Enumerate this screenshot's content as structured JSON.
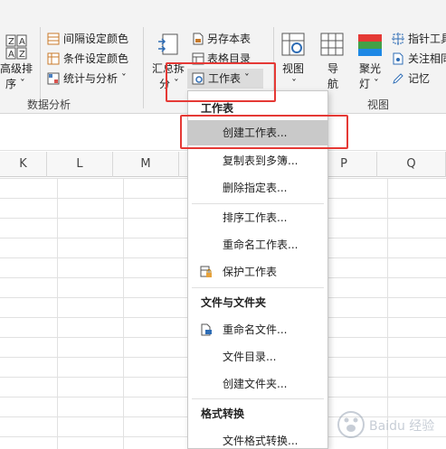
{
  "ribbon": {
    "sort_label_line1": "高级排",
    "sort_label_line2": "序 ˇ",
    "interval_color": "间隔设定颜色",
    "condition_color": "条件设定颜色",
    "stats_analysis": "统计与分析 ˇ",
    "data_analysis_group": "数据分析",
    "summarize_split_line1": "汇总拆",
    "summarize_split_line2": "分 ˇ",
    "save_sheet": "另存本表",
    "table_catalog": "表格目录",
    "worksheet_button": "工作表 ˇ",
    "view_line1": "视图",
    "view_line2": "ˇ",
    "nav_line1": "导",
    "nav_line2": "航",
    "spotlight_line1": "聚光",
    "spotlight_line2": "灯 ˇ",
    "pointer_tool": "指针工具",
    "focus_related": "关注相同",
    "note": "记忆",
    "view_group": "视图"
  },
  "columns": [
    "K",
    "L",
    "M",
    "N",
    "O",
    "P",
    "Q"
  ],
  "menu": {
    "section_worksheet": "工作表",
    "create_sheet": "创建工作表...",
    "copy_sheet": "复制表到多簿...",
    "delete_sheet": "删除指定表...",
    "sort_sheet": "排序工作表...",
    "rename_sheet": "重命名工作表...",
    "protect_sheet": "保护工作表",
    "section_files": "文件与文件夹",
    "rename_file": "重命名文件...",
    "file_catalog": "文件目录...",
    "create_folder": "创建文件夹...",
    "section_format": "格式转换",
    "file_format": "文件格式转换..."
  },
  "watermark": "Baidu 经验",
  "colors": {
    "highlight_red": "#e53935",
    "ribbon_bg": "#f3f3f3",
    "selected_item_bg": "#c9c9c9"
  }
}
